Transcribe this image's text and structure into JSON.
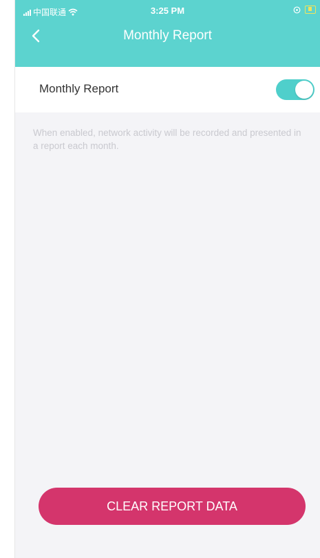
{
  "status_bar": {
    "carrier": "中国联通",
    "time": "3:25 PM"
  },
  "nav": {
    "title": "Monthly Report",
    "back_icon": "chevron-left-icon"
  },
  "setting": {
    "label": "Monthly Report",
    "enabled": true,
    "description": "When enabled, network activity will be recorded and presented in a report each month."
  },
  "actions": {
    "clear_label": "CLEAR REPORT DATA"
  },
  "colors": {
    "accent": "#5cd3cf",
    "danger": "#d4356c",
    "background": "#f4f4f7"
  }
}
